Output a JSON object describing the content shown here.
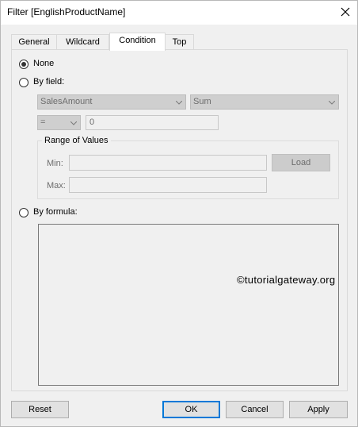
{
  "window": {
    "title": "Filter [EnglishProductName]"
  },
  "tabs": [
    {
      "label": "General"
    },
    {
      "label": "Wildcard"
    },
    {
      "label": "Condition"
    },
    {
      "label": "Top"
    }
  ],
  "condition": {
    "none_label": "None",
    "by_field_label": "By field:",
    "field_value": "SalesAmount",
    "aggregate_value": "Sum",
    "operator_value": "=",
    "value_input": "0",
    "range_group_label": "Range of Values",
    "min_label": "Min:",
    "max_label": "Max:",
    "min_value": "",
    "max_value": "",
    "load_label": "Load",
    "by_formula_label": "By formula:",
    "formula_text": ""
  },
  "watermark": "©tutorialgateway.org",
  "footer": {
    "reset": "Reset",
    "ok": "OK",
    "cancel": "Cancel",
    "apply": "Apply"
  },
  "colors": {
    "dialog_bg": "#f0f0f0",
    "default_button_border": "#0078d7",
    "disabled_fill": "#cfcfcf"
  }
}
